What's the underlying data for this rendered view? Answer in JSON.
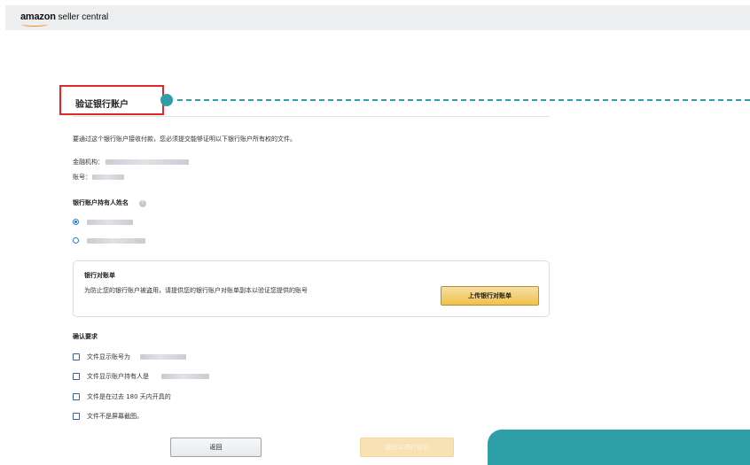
{
  "header": {
    "logo_brand": "amazon",
    "logo_rest": " seller central"
  },
  "page": {
    "title": "验证银行账户",
    "intro": "要通过这个银行账户接收付款，您必须提交能够证明以下银行账户所有权的文件。",
    "institution_label": "金融机构：",
    "account_label": "账号：",
    "holder_heading": "银行账户持有人姓名",
    "help_glyph": "?"
  },
  "statement_card": {
    "title": "银行对账单",
    "description": "为防止您的银行账户被盗用，请提供您的银行账户对账单副本以验证您提供的账号",
    "upload_label": "上传银行对账单"
  },
  "requirements": {
    "heading": "确认要求",
    "items": [
      {
        "label": "文件显示账号为"
      },
      {
        "label": "文件显示账户持有人是"
      },
      {
        "label": "文件是在过去 180 天内开具的"
      },
      {
        "label": "文件不是屏幕截图。"
      }
    ]
  },
  "actions": {
    "back_label": "返回",
    "submit_label": "提交以进行验证"
  },
  "colors": {
    "accent_teal": "#2e9fa6",
    "highlight_red": "#e3262a",
    "button_gold": "#f0c14b"
  }
}
